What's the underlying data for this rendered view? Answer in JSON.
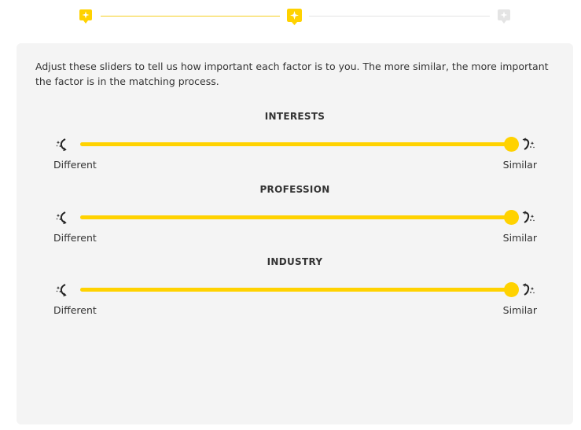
{
  "stepper": {
    "steps": [
      {
        "status": "completed",
        "icon": "sparkle-marker-icon"
      },
      {
        "status": "current",
        "icon": "sparkle-marker-icon"
      },
      {
        "status": "upcoming",
        "icon": "sparkle-marker-icon"
      }
    ],
    "active_color": "#ffd200",
    "inactive_color": "#e4e4e4"
  },
  "intro_text": "Adjust these sliders to tell us how important each factor is to you. The more similar, the more important the factor is in the matching process.",
  "factors": [
    {
      "title": "INTERESTS",
      "left_label": "Different",
      "right_label": "Similar",
      "value": 1.0,
      "left_icon": "different-icon",
      "right_icon": "similar-icon"
    },
    {
      "title": "PROFESSION",
      "left_label": "Different",
      "right_label": "Similar",
      "value": 1.0,
      "left_icon": "different-icon",
      "right_icon": "similar-icon"
    },
    {
      "title": "INDUSTRY",
      "left_label": "Different",
      "right_label": "Similar",
      "value": 1.0,
      "left_icon": "different-icon",
      "right_icon": "similar-icon"
    }
  ],
  "colors": {
    "accent": "#ffd200",
    "card_background": "#f4f4f4",
    "text": "#333333"
  }
}
